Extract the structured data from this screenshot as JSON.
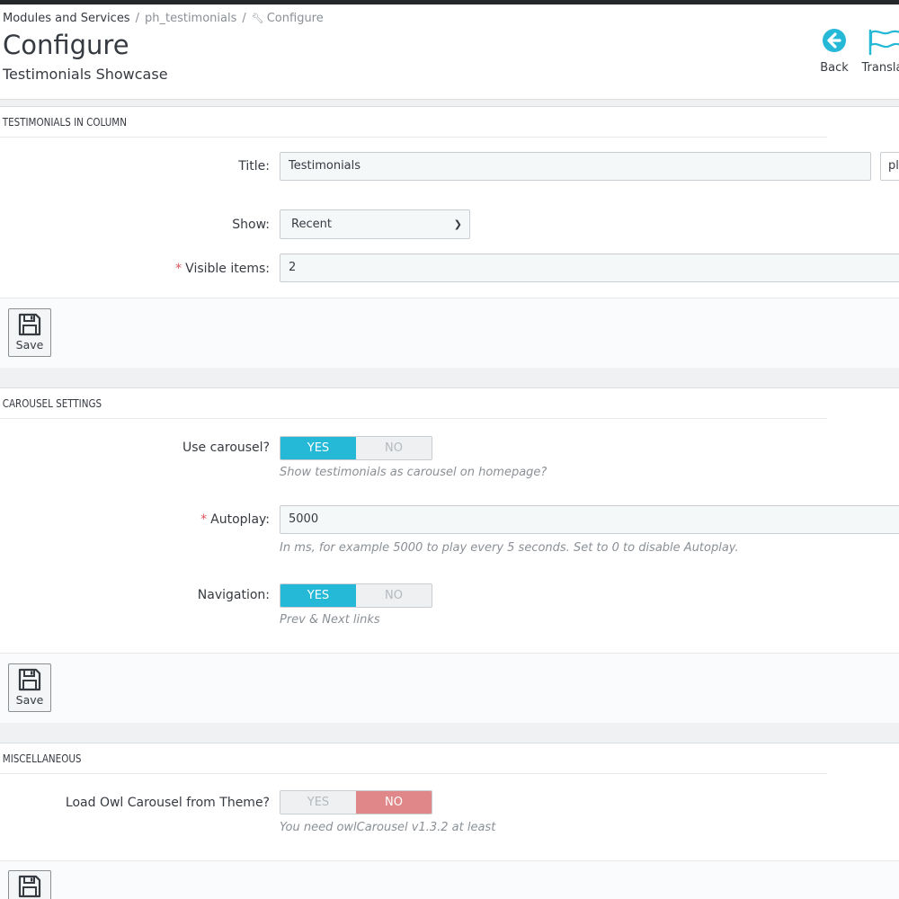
{
  "breadcrumb": {
    "item1": "Modules and Services",
    "item2": "ph_testimonials",
    "item3": "Configure",
    "separator": "/"
  },
  "header": {
    "title": "Configure",
    "subtitle": "Testimonials Showcase",
    "back_label": "Back",
    "translate_label": "Translate",
    "accent_color": "#25b9d7"
  },
  "panels": {
    "column": {
      "heading": "TESTIMONIALS IN COLUMN",
      "title_label": "Title:",
      "title_value": "Testimonials",
      "lang_code": "pl",
      "show_label": "Show:",
      "show_value": "Recent",
      "visible_label": "Visible items:",
      "visible_value": "2",
      "save_label": "Save"
    },
    "carousel": {
      "heading": "CAROUSEL SETTINGS",
      "use_label": "Use carousel?",
      "use_yes": "YES",
      "use_no": "NO",
      "use_help": "Show testimonials as carousel on homepage?",
      "autoplay_label": "Autoplay:",
      "autoplay_value": "5000",
      "autoplay_help": "In ms, for example 5000 to play every 5 seconds. Set to 0 to disable Autoplay.",
      "nav_label": "Navigation:",
      "nav_yes": "YES",
      "nav_no": "NO",
      "nav_help": "Prev & Next links",
      "save_label": "Save"
    },
    "misc": {
      "heading": "MISCELLANEOUS",
      "owl_label": "Load Owl Carousel from Theme?",
      "owl_yes": "YES",
      "owl_no": "NO",
      "owl_help": "You need owlCarousel v1.3.2 at least"
    }
  },
  "icons": {
    "back": "arrow-circle-left-icon",
    "translate": "flag-icon",
    "save": "floppy-disk-icon",
    "wrench": "wrench-icon",
    "chevron": "chevron-down-icon"
  }
}
